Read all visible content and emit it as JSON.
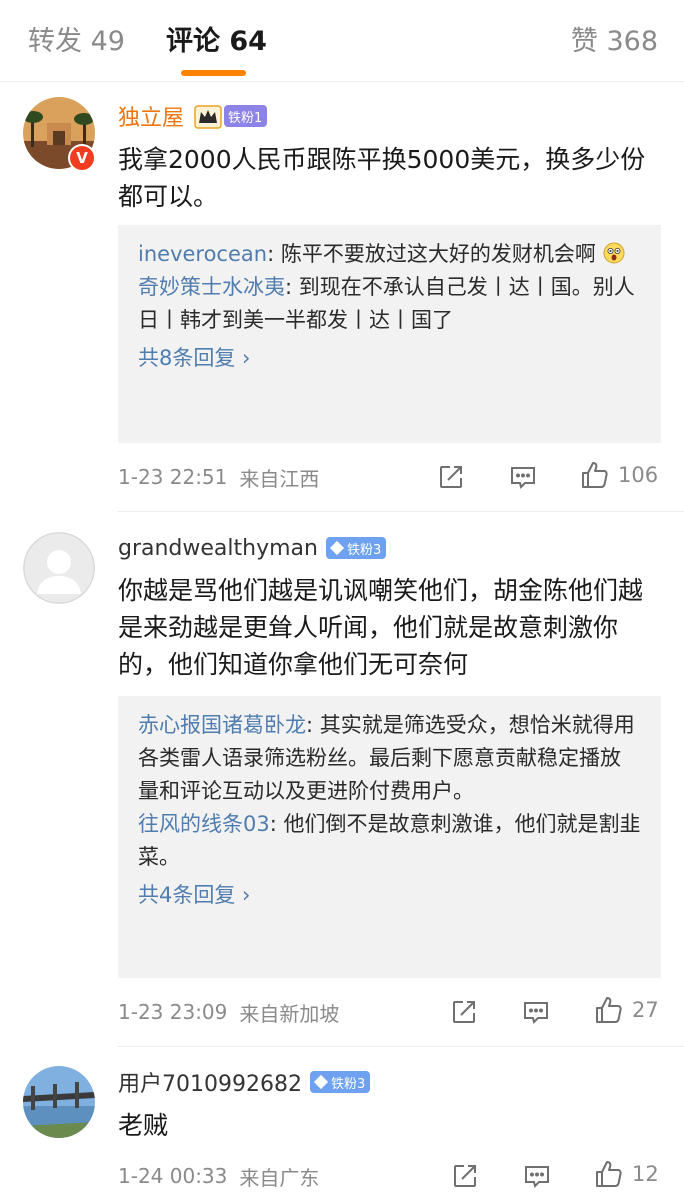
{
  "tabs": {
    "repost": "转发 49",
    "comments": "评论 64",
    "likes": "赞 368"
  },
  "colors": {
    "accent": "#ff8200",
    "link": "#507daf",
    "vip_name": "#ee7510"
  },
  "comments": [
    {
      "username": "独立屋",
      "verified_badge": "V",
      "fan_badge": "铁粉1",
      "text": "我拿2000人民币跟陈平换5000美元，换多少份都可以。",
      "replies": [
        {
          "name": "ineverocean",
          "text": ": 陈平不要放过这大好的发财机会啊"
        },
        {
          "name": "奇妙策士水冰夷",
          "text": ": 到现在不承认自己发丨达丨国。别人日丨韩才到美一半都发丨达丨国了"
        }
      ],
      "more_replies": "共8条回复 ›",
      "time": "1-23 22:51",
      "source": "来自江西",
      "like_count": "106"
    },
    {
      "username": "grandwealthyman",
      "fan_badge": "铁粉3",
      "text": "你越是骂他们越是讥讽嘲笑他们，胡金陈他们越是来劲越是更耸人听闻，他们就是故意刺激你的，他们知道你拿他们无可奈何",
      "replies": [
        {
          "name": "赤心报国诸葛卧龙",
          "text": ": 其实就是筛选受众，想恰米就得用各类雷人语录筛选粉丝。最后剩下愿意贡献稳定播放量和评论互动以及更进阶付费用户。"
        },
        {
          "name": "往风的线条03",
          "text": ": 他们倒不是故意刺激谁，他们就是割韭菜。"
        }
      ],
      "more_replies": "共4条回复 ›",
      "time": "1-23 23:09",
      "source": "来自新加坡",
      "like_count": "27"
    },
    {
      "username": "用户7010992682",
      "fan_badge": "铁粉3",
      "text": "老贼",
      "time": "1-24 00:33",
      "source": "来自广东",
      "like_count": "12"
    }
  ]
}
